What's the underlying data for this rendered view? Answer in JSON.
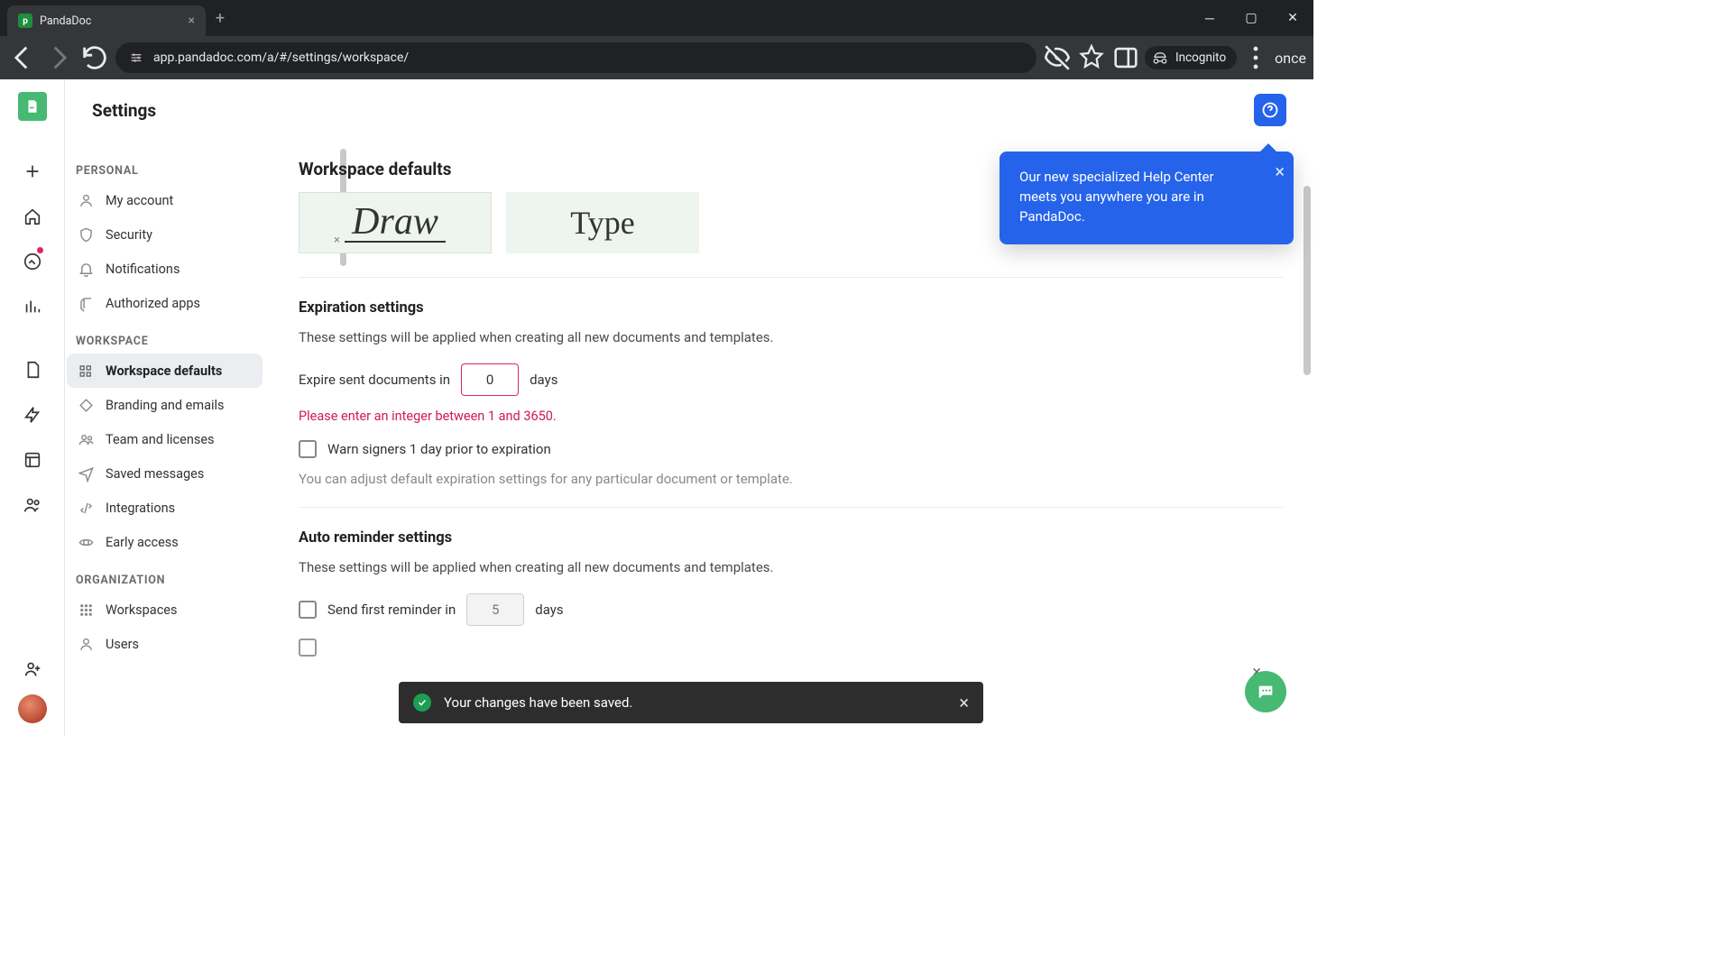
{
  "browser": {
    "tab_title": "PandaDoc",
    "url": "app.pandadoc.com/a/#/settings/workspace/",
    "incognito_label": "Incognito"
  },
  "page": {
    "title": "Settings"
  },
  "sidebar": {
    "personal_label": "PERSONAL",
    "personal": [
      {
        "label": "My account"
      },
      {
        "label": "Security"
      },
      {
        "label": "Notifications"
      },
      {
        "label": "Authorized apps"
      }
    ],
    "workspace_label": "WORKSPACE",
    "workspace": [
      {
        "label": "Workspace defaults"
      },
      {
        "label": "Branding and emails"
      },
      {
        "label": "Team and licenses"
      },
      {
        "label": "Saved messages"
      },
      {
        "label": "Integrations"
      },
      {
        "label": "Early access"
      }
    ],
    "organization_label": "ORGANIZATION",
    "organization": [
      {
        "label": "Workspaces"
      },
      {
        "label": "Users"
      }
    ]
  },
  "main": {
    "heading": "Workspace defaults",
    "sig_draw": "Draw",
    "sig_type": "Type",
    "expiration": {
      "heading": "Expiration settings",
      "desc": "These settings will be applied when creating all new documents and templates.",
      "expire_prefix": "Expire sent documents in",
      "expire_value": "0",
      "expire_suffix": "days",
      "error": "Please enter an integer between 1 and 3650.",
      "warn_label": "Warn signers 1 day prior to expiration",
      "hint": "You can adjust default expiration settings for any particular document or template."
    },
    "reminder": {
      "heading": "Auto reminder settings",
      "desc": "These settings will be applied when creating all new documents and templates.",
      "first_prefix": "Send first reminder in",
      "first_value": "5",
      "first_suffix": "days"
    }
  },
  "popover": {
    "text": "Our new specialized Help Center meets you anywhere you are in PandaDoc."
  },
  "toast": {
    "text": "Your changes have been saved."
  }
}
